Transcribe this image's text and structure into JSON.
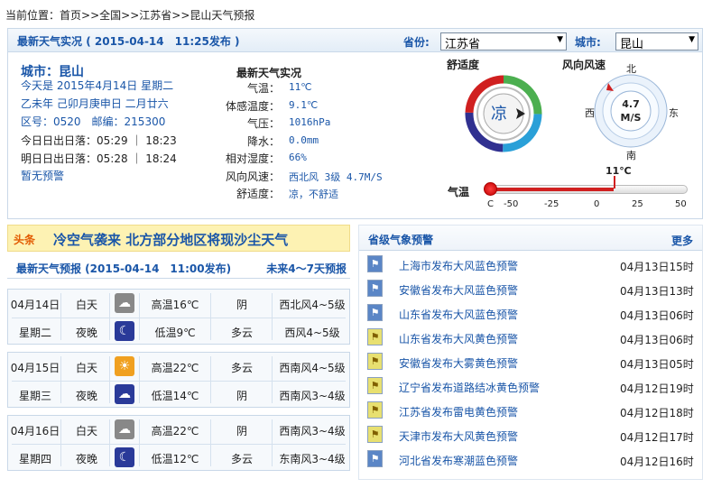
{
  "breadcrumb": {
    "prefix": "当前位置：",
    "home": "首页",
    "sep": ">>",
    "national": "全国",
    "province": "江苏省",
    "current": "昆山天气预报"
  },
  "current_header": {
    "title": "最新天气实况",
    "time": "( 2015-04-14　11:25发布 )",
    "province_label": "省份:",
    "province_value": "江苏省",
    "city_label": "城市:",
    "city_value": "昆山"
  },
  "info": {
    "city": "城市：昆山",
    "today": "今天是 2015年4月14日 星期二",
    "lunar": "乙未年 己卯月庚申日 二月廿六",
    "code": "区号：0520　邮编：215300",
    "today_sun": "今日日出日落：05:29 ｜ 18:23",
    "tomorrow_sun": "明日日出日落：05:28 ｜ 18:24",
    "alert": "暂无预警"
  },
  "obs": {
    "title": "最新天气实况",
    "rows": [
      {
        "label": "气温：",
        "value": "11℃"
      },
      {
        "label": "体感温度：",
        "value": "9.1℃"
      },
      {
        "label": "气压：",
        "value": "1016hPa"
      },
      {
        "label": "降水：",
        "value": "0.0mm"
      },
      {
        "label": "相对湿度：",
        "value": "66%"
      },
      {
        "label": "风向风速：",
        "value": "西北风 3级 4.7M/S"
      },
      {
        "label": "舒适度：",
        "value": "凉，不舒适"
      }
    ]
  },
  "gauges": {
    "comfort_title": "舒适度",
    "comfort_value": "凉",
    "wind_title": "风向风速",
    "wind_speed": "4.7",
    "wind_unit": "M/S",
    "north": "北",
    "south": "南",
    "east": "东",
    "west": "西",
    "temp_title": "气温",
    "temp_value": "11℃",
    "temp_unit": "C",
    "ticks": [
      "-50",
      "-25",
      "0",
      "25",
      "50"
    ],
    "temp_c": 11
  },
  "news": {
    "tag": "头条",
    "text": "冷空气袭来 北方部分地区将现沙尘天气"
  },
  "forecast": {
    "title": "最新天气预报 (2015-04-14　11:00发布)",
    "more": "未来4～7天预报",
    "days": [
      {
        "date": "04月14日",
        "weekday": "星期二",
        "day": {
          "period": "白天",
          "icon": "cloud-icon",
          "temp": "高温16℃",
          "wx": "阴",
          "wind": "西北风4~5级"
        },
        "night": {
          "period": "夜晚",
          "icon": "moon-icon",
          "temp": "低温9℃",
          "wx": "多云",
          "wind": "西风4~5级"
        }
      },
      {
        "date": "04月15日",
        "weekday": "星期三",
        "day": {
          "period": "白天",
          "icon": "sun-cloud-icon",
          "temp": "高温22℃",
          "wx": "多云",
          "wind": "西南风4~5级"
        },
        "night": {
          "period": "夜晚",
          "icon": "night-cloud-icon",
          "temp": "低温14℃",
          "wx": "阴",
          "wind": "西南风3~4级"
        }
      },
      {
        "date": "04月16日",
        "weekday": "星期四",
        "day": {
          "period": "白天",
          "icon": "cloud-icon",
          "temp": "高温22℃",
          "wx": "阴",
          "wind": "西南风3~4级"
        },
        "night": {
          "period": "夜晚",
          "icon": "moon-icon",
          "temp": "低温12℃",
          "wx": "多云",
          "wind": "东南风3~4级"
        }
      }
    ]
  },
  "warnings": {
    "title": "省级气象预警",
    "more": "更多",
    "items": [
      {
        "text": "上海市发布大风蓝色预警",
        "date": "04月13日15时",
        "level": "blue"
      },
      {
        "text": "安徽省发布大风蓝色预警",
        "date": "04月13日13时",
        "level": "blue"
      },
      {
        "text": "山东省发布大风蓝色预警",
        "date": "04月13日06时",
        "level": "blue"
      },
      {
        "text": "山东省发布大风黄色预警",
        "date": "04月13日06时",
        "level": "yellow"
      },
      {
        "text": "安徽省发布大雾黄色预警",
        "date": "04月13日05时",
        "level": "yellow"
      },
      {
        "text": "辽宁省发布道路结冰黄色预警",
        "date": "04月12日19时",
        "level": "yellow"
      },
      {
        "text": "江苏省发布雷电黄色预警",
        "date": "04月12日18时",
        "level": "yellow"
      },
      {
        "text": "天津市发布大风黄色预警",
        "date": "04月12日17时",
        "level": "yellow"
      },
      {
        "text": "河北省发布寒潮蓝色预警",
        "date": "04月12日16时",
        "level": "blue"
      }
    ]
  }
}
